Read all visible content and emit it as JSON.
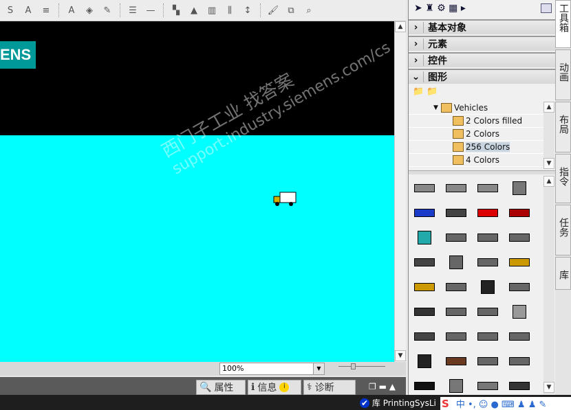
{
  "toolbar": {
    "icons": [
      "strikethrough-icon",
      "font-size-icon",
      "align-icon",
      "font-color-icon",
      "fill-color-icon",
      "line-color-icon",
      "line-width-icon",
      "line-style-icon",
      "group-icon",
      "align-objects-icon",
      "distribute-icon",
      "spacing-icon",
      "height-icon",
      "format-painter-icon",
      "layer-icon",
      "zoom-area-icon"
    ]
  },
  "canvas": {
    "logo": "ENS",
    "background": "#00ffff",
    "logo_color": "#009999"
  },
  "watermark": {
    "line1": "西门子工业  找答案",
    "line2": "support.industry.siemens.com/cs"
  },
  "zoom": {
    "value": "100%"
  },
  "inspector_tabs": [
    {
      "label": "属性"
    },
    {
      "label": "信息"
    },
    {
      "label": "诊断"
    }
  ],
  "toolbox": {
    "sections": [
      {
        "label": "基本对象",
        "expanded": false
      },
      {
        "label": "元素",
        "expanded": false
      },
      {
        "label": "控件",
        "expanded": false
      },
      {
        "label": "图形",
        "expanded": true
      }
    ],
    "tree": {
      "folder": "Vehicles",
      "items": [
        "2 Colors filled",
        "2 Colors",
        "256 Colors",
        "4 Colors"
      ],
      "selected": "256 Colors"
    }
  },
  "right_tabs": [
    "工具箱",
    "动画",
    "布局",
    "指令",
    "任务",
    "库"
  ],
  "taskbar": {
    "library": "库 PrintingSysLi"
  }
}
